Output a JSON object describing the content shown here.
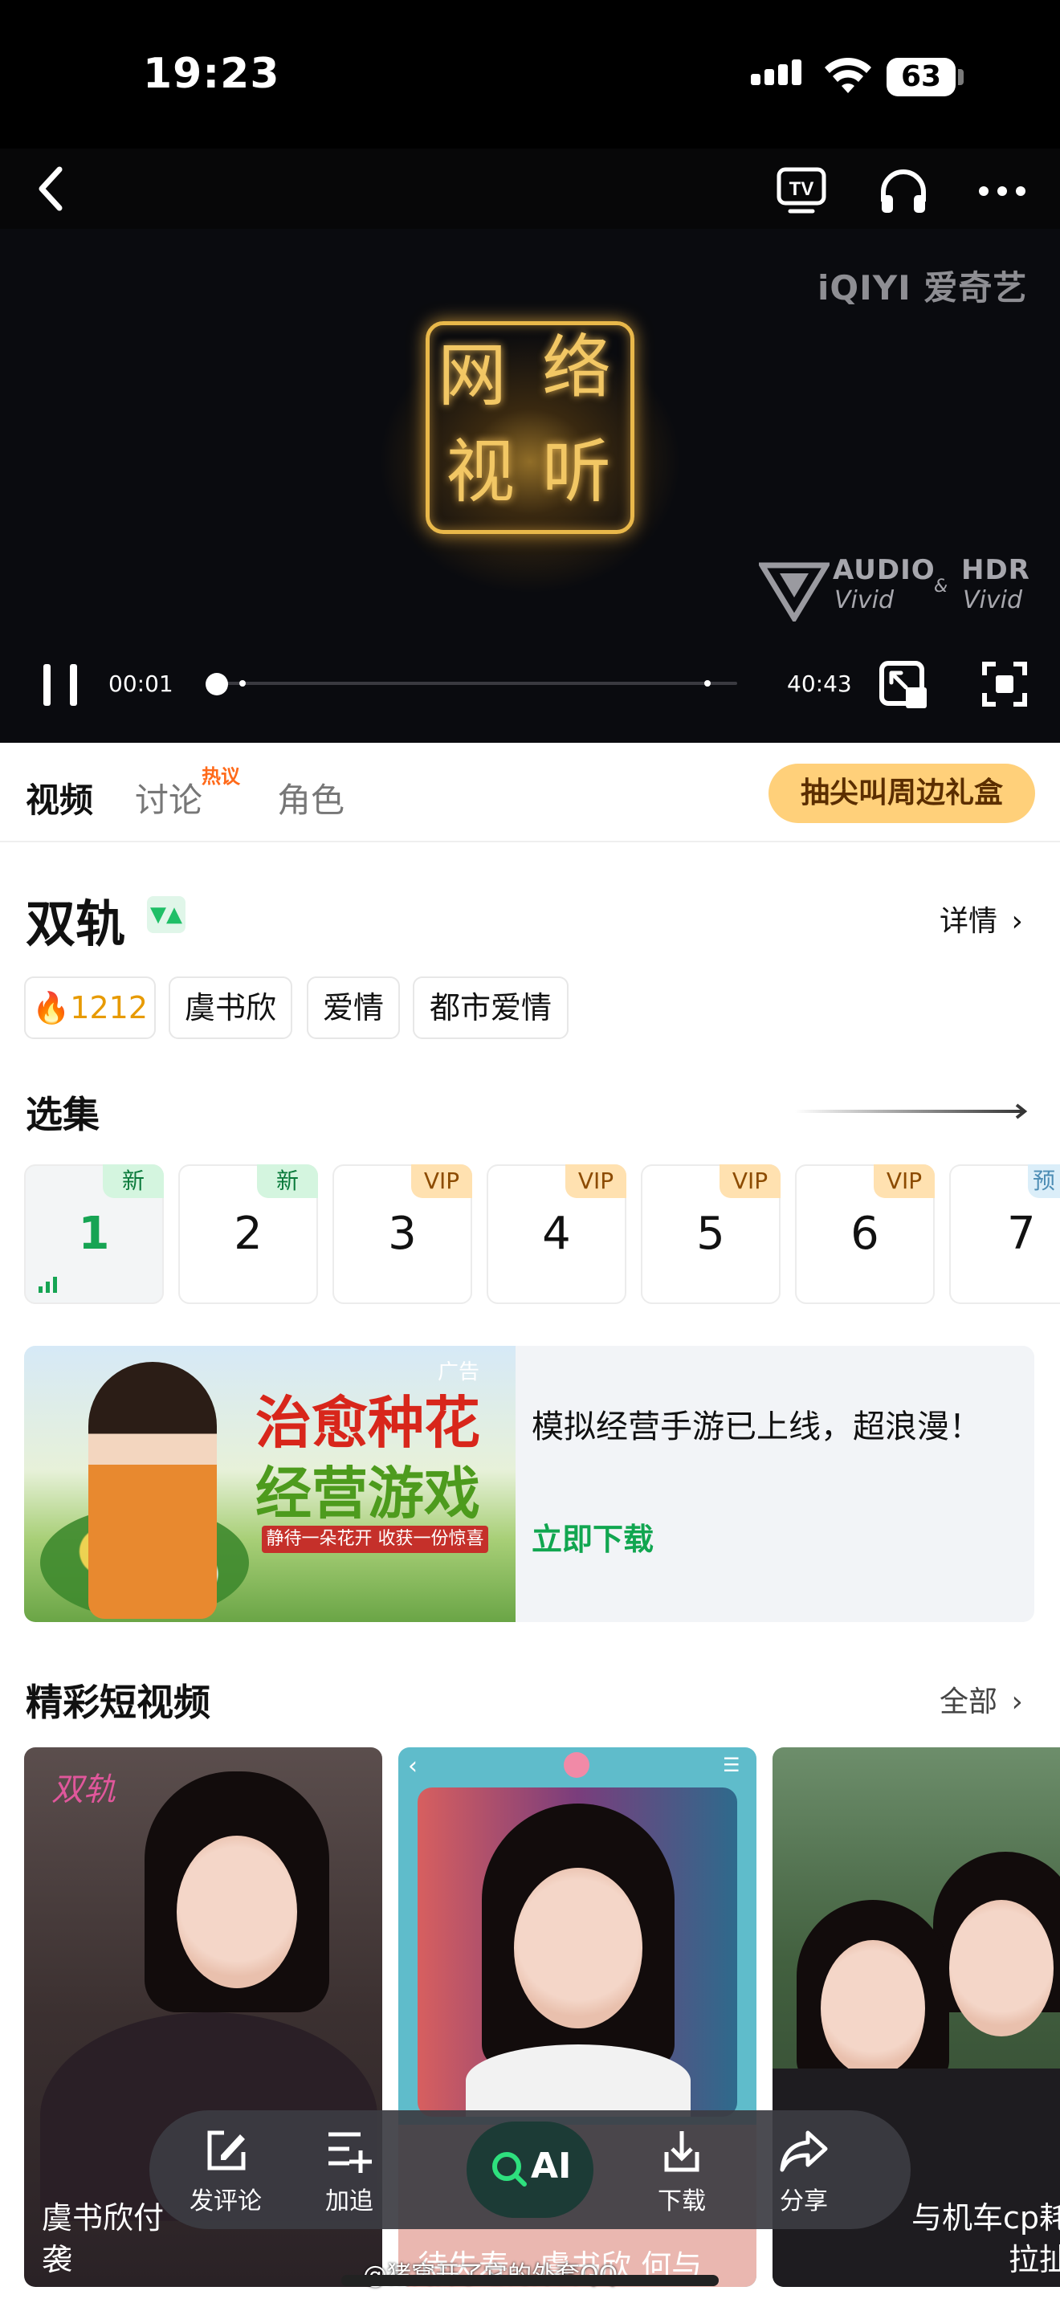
{
  "status": {
    "time": "19:23",
    "battery": "63"
  },
  "player": {
    "watermark": "iQIYI 爱奇艺",
    "seal_chars": [
      "网",
      "络",
      "视",
      "听"
    ],
    "audio_badge": {
      "a1": "AUDIO",
      "a2": "Vivid",
      "amp": "&",
      "h1": "HDR",
      "h2": "Vivid"
    },
    "current_time": "00:01",
    "duration": "40:43",
    "progress_fraction": 0.0004,
    "icons": [
      "back-icon",
      "tv-cast-icon",
      "headphones-icon",
      "more-icon",
      "pause-icon",
      "pip-icon",
      "fullscreen-icon"
    ]
  },
  "tabs": {
    "video": "视频",
    "discuss": "讨论",
    "hot_badge": "热议",
    "roles": "角色",
    "gift": "抽尖叫周边礼盒"
  },
  "show": {
    "title": "双轨",
    "details": "详情",
    "tags": [
      {
        "label": "1212",
        "heat": true
      },
      {
        "label": "虞书欣"
      },
      {
        "label": "爱情"
      },
      {
        "label": "都市爱情"
      }
    ]
  },
  "episodes": {
    "heading": "选集",
    "items": [
      {
        "num": "1",
        "badge": "新",
        "type": "new",
        "playing": true
      },
      {
        "num": "2",
        "badge": "新",
        "type": "new"
      },
      {
        "num": "3",
        "badge": "VIP",
        "type": "vip"
      },
      {
        "num": "4",
        "badge": "VIP",
        "type": "vip"
      },
      {
        "num": "5",
        "badge": "VIP",
        "type": "vip"
      },
      {
        "num": "6",
        "badge": "VIP",
        "type": "vip"
      },
      {
        "num": "7",
        "badge": "预",
        "type": "pre"
      }
    ]
  },
  "ad": {
    "label": "广告",
    "image_line1": "治愈种花",
    "image_line2": "经营游戏",
    "image_line3": "静待一朵花开 收获一份惊喜",
    "text": "模拟经营手游已上线，超浪漫！",
    "cta": "立即下载"
  },
  "shorts": {
    "heading": "精彩短视频",
    "all": "全部",
    "cards": [
      {
        "logo": "双轨",
        "caption": "虞书欣付袭"
      },
      {
        "caption": "待失寿。虞书欣 何与"
      },
      {
        "caption": "与机车cp耗拉扯"
      }
    ]
  },
  "dock": {
    "comment": "发评论",
    "follow": "加追",
    "ai": "AI",
    "download": "下载",
    "share": "分享"
  },
  "weibo_watermark": "@猪窝开了它的外套QQ"
}
